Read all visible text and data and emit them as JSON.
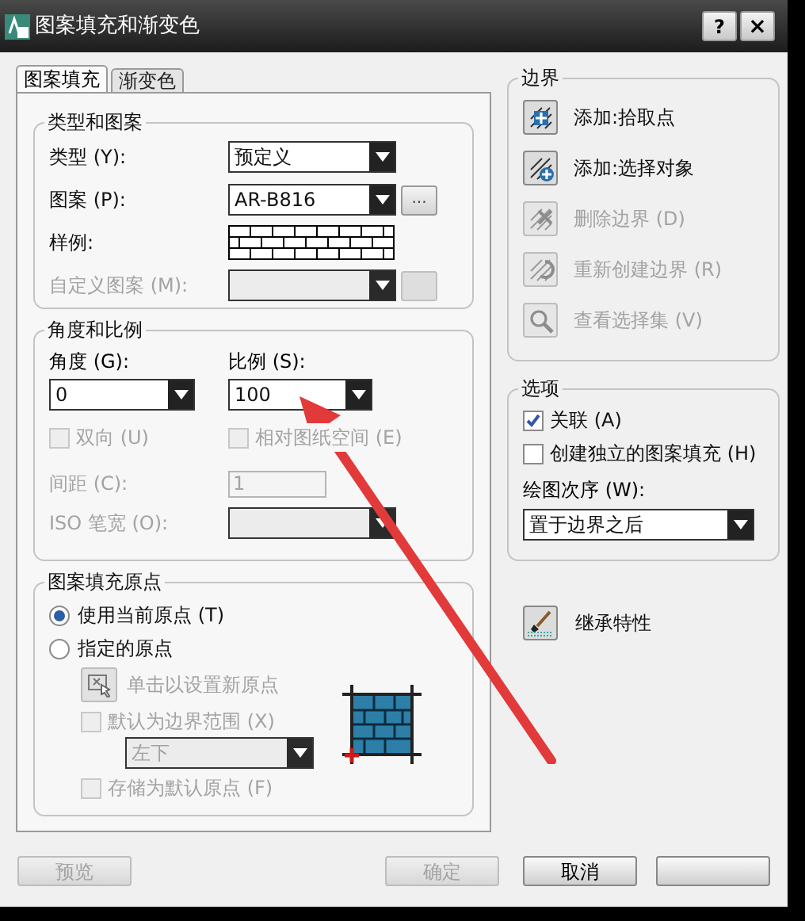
{
  "window": {
    "title": "图案填充和渐变色",
    "help_button": "?",
    "close_button": "×"
  },
  "tabs": [
    {
      "label": "图案填充",
      "selected": true
    },
    {
      "label": "渐变色",
      "selected": false
    }
  ],
  "type_and_pattern": {
    "title": "类型和图案",
    "rows": [
      {
        "kind": "combo",
        "label": "类型 (Y):",
        "value": "预定义",
        "disabled": false
      },
      {
        "kind": "combo",
        "label": "图案 (P):",
        "value": "AR-B816",
        "disabled": false,
        "browse": {
          "label": "...",
          "disabled": false
        }
      },
      {
        "kind": "swatch",
        "label": "样例:"
      },
      {
        "kind": "combo",
        "label": "自定义图案 (M):",
        "disabled": true,
        "browse": {
          "disabled": true
        }
      }
    ]
  },
  "angle_and_scale": {
    "title": "角度和比例",
    "angle": {
      "label": "角度 (G):",
      "value": "0"
    },
    "scale": {
      "label": "比例 (S):",
      "value": "100"
    },
    "checkboxes": [
      {
        "label": "双向 (U)",
        "checked": false,
        "disabled": true
      },
      {
        "label": "相对图纸空间 (E)",
        "checked": false,
        "disabled": true
      }
    ],
    "spacing": {
      "label": "间距 (C):",
      "value": "1",
      "disabled": true
    },
    "iso_pen_width": {
      "label": "ISO 笔宽 (O):",
      "disabled": true
    }
  },
  "hatch_origin": {
    "title": "图案填充原点",
    "radios": [
      {
        "label": "使用当前原点 (T)",
        "selected": true
      },
      {
        "label": "指定的原点",
        "selected": false
      }
    ],
    "set_origin_button": {
      "label": "单击以设置新原点",
      "disabled": true
    },
    "default_extent": {
      "label": "默认为边界范围 (X)",
      "checked": false,
      "disabled": true
    },
    "position": {
      "value": "左下",
      "disabled": true
    },
    "store_default": {
      "label": "存储为默认原点 (F)",
      "checked": false,
      "disabled": true
    }
  },
  "boundaries": {
    "title": "边界",
    "buttons": [
      {
        "kind": "pick",
        "label": "添加:拾取点",
        "disabled": false
      },
      {
        "kind": "select",
        "label": "添加:选择对象",
        "disabled": false
      },
      {
        "kind": "remove",
        "label": "删除边界 (D)",
        "disabled": true
      },
      {
        "kind": "recreate",
        "label": "重新创建边界 (R)",
        "disabled": true
      },
      {
        "kind": "view",
        "label": "查看选择集 (V)",
        "disabled": true
      }
    ]
  },
  "options": {
    "title": "选项",
    "checkboxes": [
      {
        "label": "关联 (A)",
        "checked": true,
        "disabled": false
      },
      {
        "label": "创建独立的图案填充 (H)",
        "checked": false,
        "disabled": false
      }
    ],
    "draw_order": {
      "label": "绘图次序 (W):",
      "value": "置于边界之后"
    }
  },
  "inherit_button": {
    "label": "继承特性"
  },
  "footer_buttons": [
    {
      "label": "预览",
      "disabled": true
    },
    {
      "label": "确定",
      "disabled": true
    },
    {
      "label": "取消",
      "disabled": false
    },
    {
      "disabled": false
    }
  ]
}
